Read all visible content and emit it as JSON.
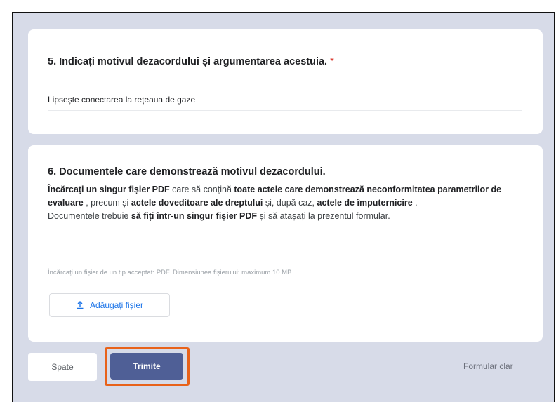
{
  "question5": {
    "title": "5. Indicați motivul dezacordului și argumentarea acestuia.",
    "required_mark": "*",
    "answer": "Lipsește conectarea la rețeaua de gaze"
  },
  "question6": {
    "title": "6. Documentele care demonstrează motivul dezacordului.",
    "desc": {
      "p1": "Încărcați un singur fișier PDF",
      "p2": " care să conțină ",
      "p3": "toate actele care demonstrează neconformitatea parametrilor de evaluare",
      "p4": " , precum și ",
      "p5": "actele doveditoare ale dreptului",
      "p6": " și, după caz, ",
      "p7": "actele de împuternicire",
      "p8": " .",
      "p9": "Documentele trebuie ",
      "p10": "să fiți într-un singur fișier PDF",
      "p11": " și să atașați la prezentul formular."
    },
    "hint": "Încărcați un fișier de un tip acceptat: PDF. Dimensiunea fișierului: maximum 10 MB.",
    "add_file_label": "Adăugați fișier"
  },
  "footer": {
    "back_label": "Spate",
    "submit_label": "Trimite",
    "clear_label": "Formular clar"
  },
  "colors": {
    "background": "#d7dbe8",
    "submit": "#4f5f96",
    "highlight": "#e8621a",
    "required": "#d93025",
    "link": "#1a73e8"
  },
  "icons": {
    "add_file": "upload-icon"
  }
}
